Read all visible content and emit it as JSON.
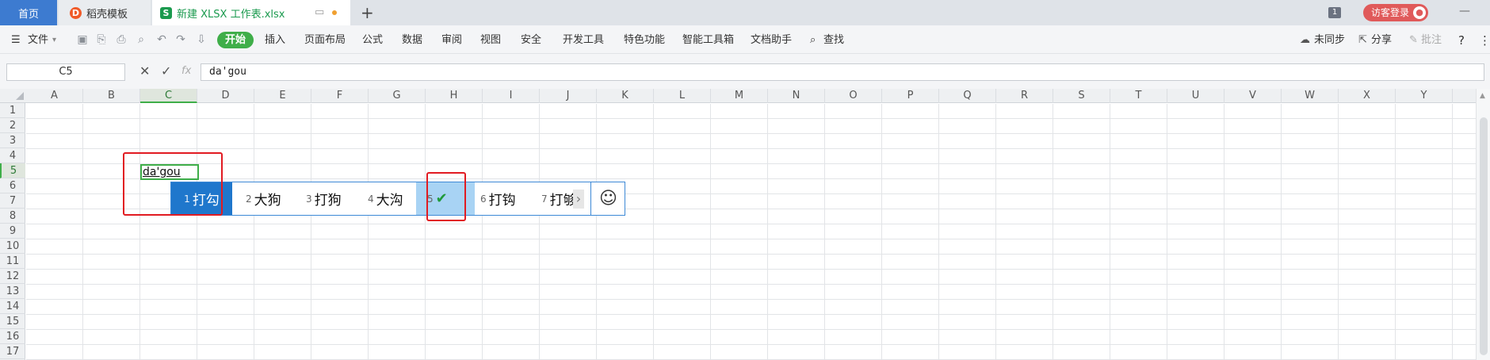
{
  "tabs": {
    "home": "首页",
    "templates": "稻壳模板",
    "file": "新建 XLSX 工作表.xlsx"
  },
  "topright": {
    "badge": "1",
    "login": "访客登录"
  },
  "ribbon": {
    "file_menu": "文件",
    "start": "开始",
    "items": [
      "插入",
      "页面布局",
      "公式",
      "数据",
      "审阅",
      "视图",
      "安全",
      "开发工具",
      "特色功能",
      "智能工具箱",
      "文档助手"
    ],
    "search": "查找",
    "sync": "未同步",
    "share": "分享",
    "comment": "批注",
    "help": "?"
  },
  "formula_bar": {
    "name_box": "C5",
    "fx": "fx",
    "value": "da'gou"
  },
  "grid": {
    "columns": [
      "A",
      "B",
      "C",
      "D",
      "E",
      "F",
      "G",
      "H",
      "I",
      "J",
      "K",
      "L",
      "M",
      "N",
      "O",
      "P",
      "Q",
      "R",
      "S",
      "T",
      "U",
      "V",
      "W",
      "X",
      "Y"
    ],
    "rows": [
      "1",
      "2",
      "3",
      "4",
      "5",
      "6",
      "7",
      "8",
      "9",
      "10",
      "11",
      "12",
      "13",
      "14",
      "15",
      "16",
      "17"
    ],
    "active_cell_text": "da'gou"
  },
  "ime": {
    "candidates": [
      {
        "num": "1",
        "text": "打勾"
      },
      {
        "num": "2",
        "text": "大狗"
      },
      {
        "num": "3",
        "text": "打狗"
      },
      {
        "num": "4",
        "text": "大沟"
      },
      {
        "num": "5",
        "text": "✔"
      },
      {
        "num": "6",
        "text": "打钩"
      },
      {
        "num": "7",
        "text": "打够"
      }
    ]
  },
  "colors": {
    "accent_green": "#3fae49",
    "highlight_red": "#e11b22",
    "ime_selected": "#1f77cc"
  }
}
